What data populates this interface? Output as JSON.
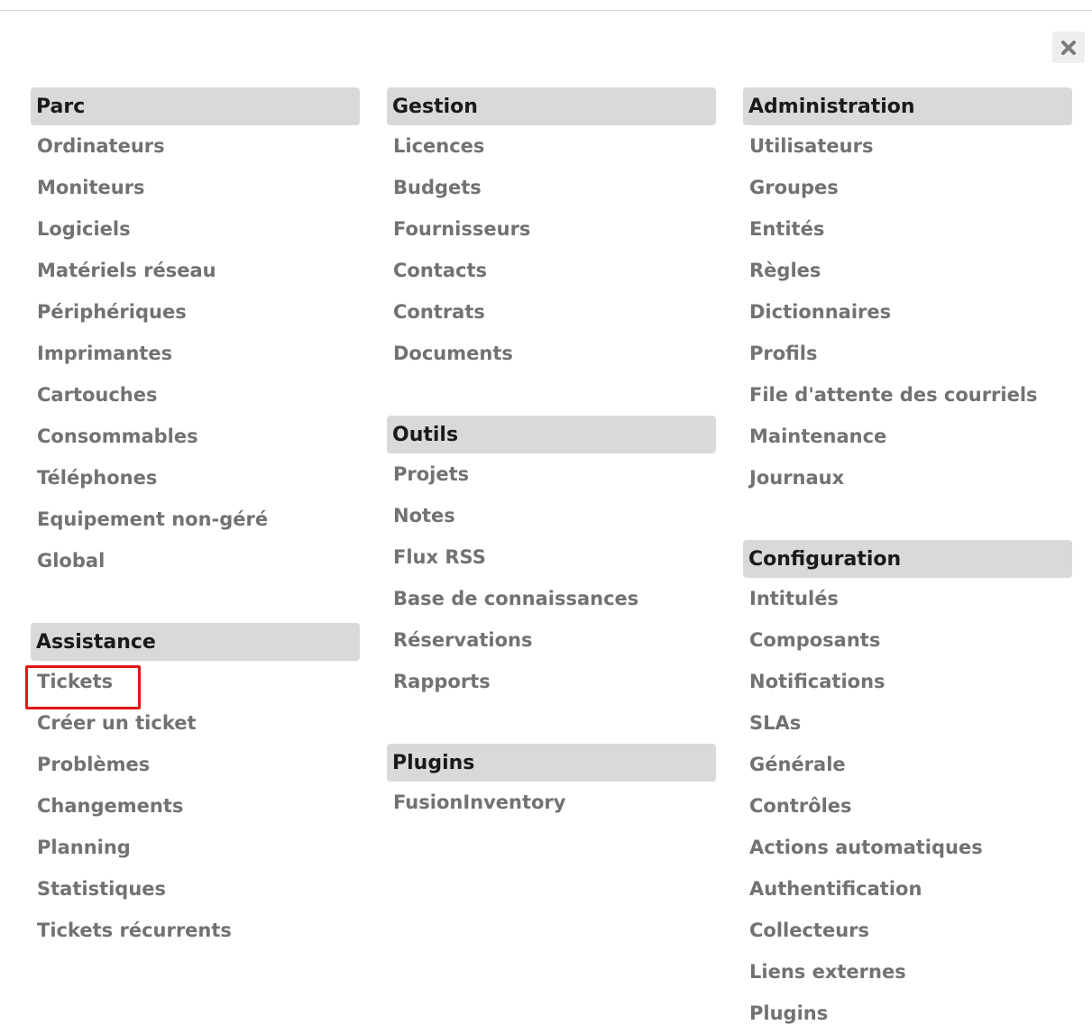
{
  "close": {
    "icon": "close-icon"
  },
  "sections": {
    "parc": {
      "title": "Parc",
      "items": [
        "Ordinateurs",
        "Moniteurs",
        "Logiciels",
        "Matériels réseau",
        "Périphériques",
        "Imprimantes",
        "Cartouches",
        "Consommables",
        "Téléphones",
        "Equipement non-géré",
        "Global"
      ]
    },
    "assistance": {
      "title": "Assistance",
      "items": [
        "Tickets",
        "Créer un ticket",
        "Problèmes",
        "Changements",
        "Planning",
        "Statistiques",
        "Tickets récurrents"
      ]
    },
    "gestion": {
      "title": "Gestion",
      "items": [
        "Licences",
        "Budgets",
        "Fournisseurs",
        "Contacts",
        "Contrats",
        "Documents"
      ]
    },
    "outils": {
      "title": "Outils",
      "items": [
        "Projets",
        "Notes",
        "Flux RSS",
        "Base de connaissances",
        "Réservations",
        "Rapports"
      ]
    },
    "plugins": {
      "title": "Plugins",
      "items": [
        "FusionInventory"
      ]
    },
    "administration": {
      "title": "Administration",
      "items": [
        "Utilisateurs",
        "Groupes",
        "Entités",
        "Règles",
        "Dictionnaires",
        "Profils",
        "File d'attente des courriels",
        "Maintenance",
        "Journaux"
      ]
    },
    "configuration": {
      "title": "Configuration",
      "items": [
        "Intitulés",
        "Composants",
        "Notifications",
        "SLAs",
        "Générale",
        "Contrôles",
        "Actions automatiques",
        "Authentification",
        "Collecteurs",
        "Liens externes",
        "Plugins"
      ]
    }
  },
  "colors": {
    "header_bg": "#d9d9d9",
    "link": "#727272",
    "highlight": "#e01616"
  }
}
